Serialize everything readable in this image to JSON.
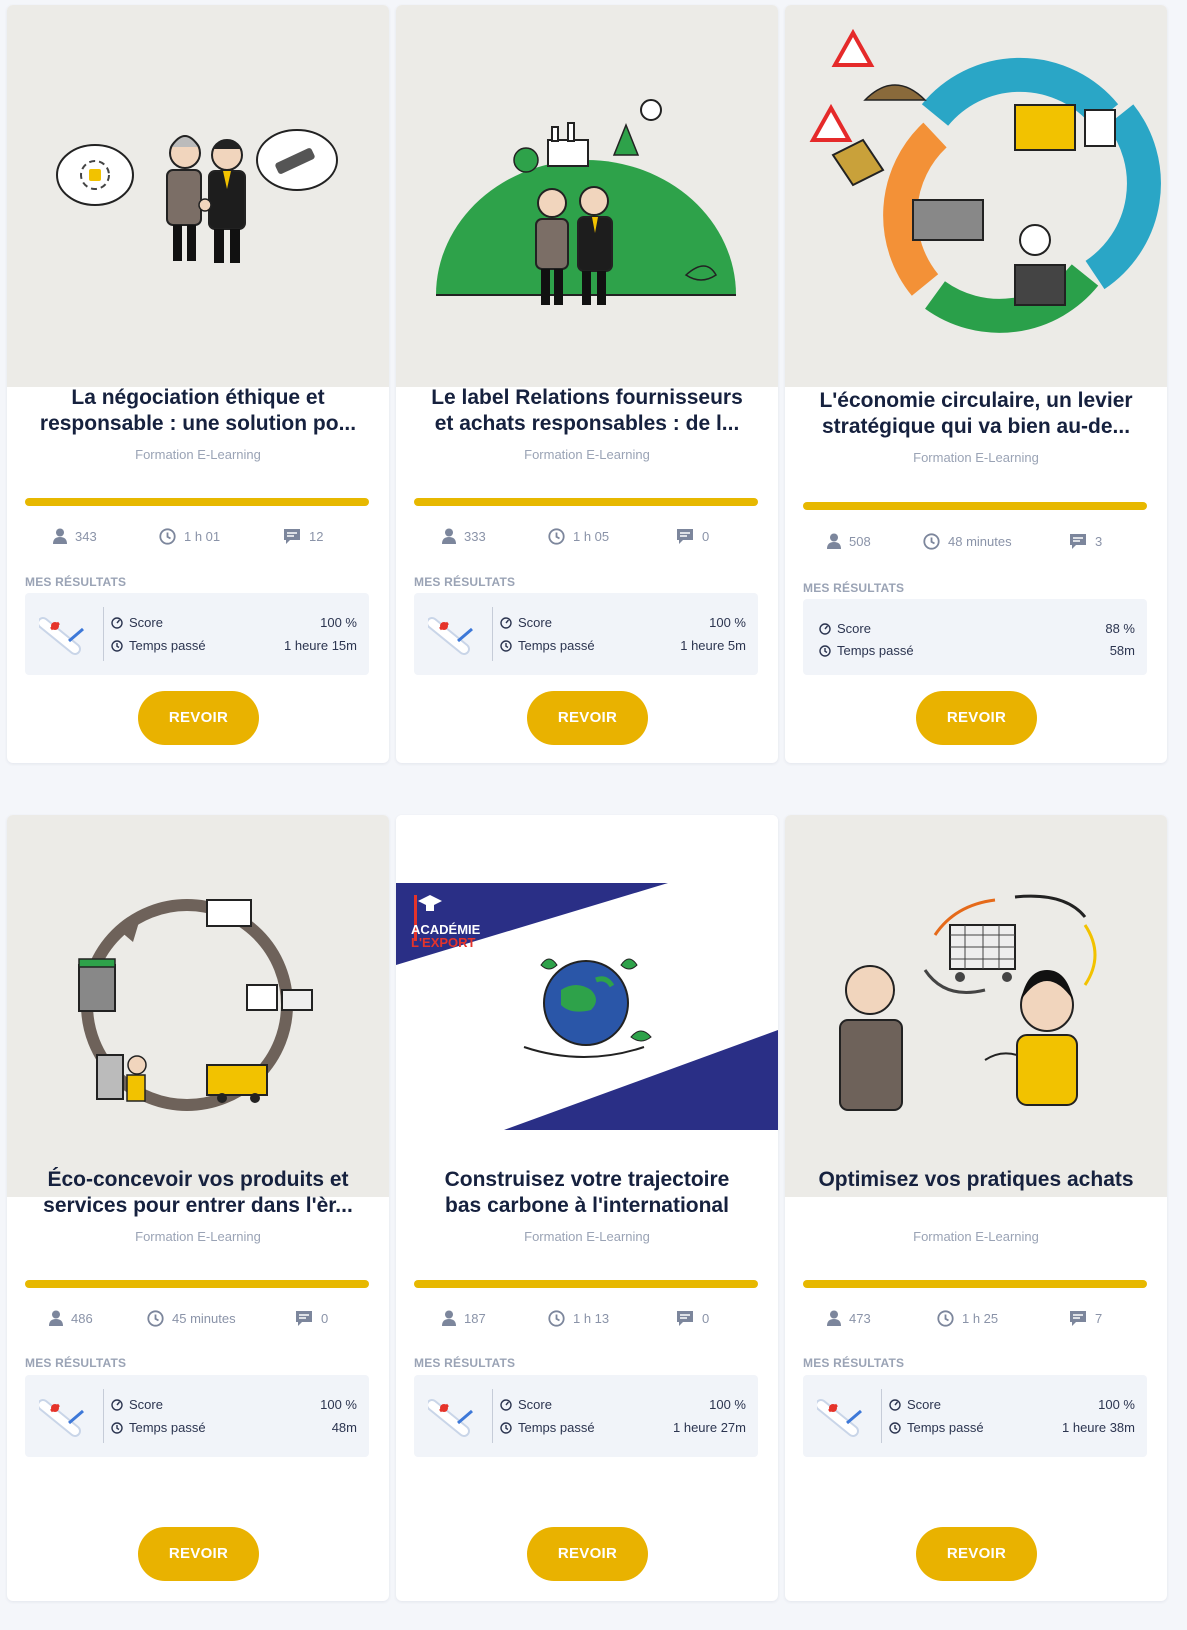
{
  "accent_color": "#e9b200",
  "cards": [
    {
      "title_line1": "La négociation éthique et",
      "title_line2": "responsable : une solution po...",
      "subtitle": "Formation E-Learning",
      "progress": 1.0,
      "stats": {
        "users": "343",
        "duration": "1 h 01",
        "comments": "12"
      },
      "results_label": "MES RÉSULTATS",
      "score_label": "Score",
      "score_value": "100 %",
      "time_label": "Temps passé",
      "time_value": "1 heure 15m",
      "button_label": "REVOIR",
      "illustration": "negotiation-handshake"
    },
    {
      "title_line1": "Le label Relations fournisseurs",
      "title_line2": "et achats responsables : de l...",
      "subtitle": "Formation E-Learning",
      "progress": 1.0,
      "stats": {
        "users": "333",
        "duration": "1 h 05",
        "comments": "0"
      },
      "results_label": "MES RÉSULTATS",
      "score_label": "Score",
      "score_value": "100 %",
      "time_label": "Temps passé",
      "time_value": "1 heure 5m",
      "button_label": "REVOIR",
      "illustration": "green-planet-handshake"
    },
    {
      "title_line1": "L'économie circulaire, un levier",
      "title_line2": "stratégique qui va bien au-de...",
      "subtitle": "Formation E-Learning",
      "progress": 1.0,
      "stats": {
        "users": "508",
        "duration": "48 minutes",
        "comments": "3"
      },
      "results_label": "MES RÉSULTATS",
      "score_label": "Score",
      "score_value": "88 %",
      "time_label": "Temps passé",
      "time_value": "58m",
      "button_label": "REVOIR",
      "illustration": "circular-economy-arrows"
    },
    {
      "title_line1": "Éco-concevoir vos produits et",
      "title_line2": "services pour entrer dans l'èr...",
      "subtitle": "Formation E-Learning",
      "progress": 1.0,
      "stats": {
        "users": "486",
        "duration": "45 minutes",
        "comments": "0"
      },
      "results_label": "MES RÉSULTATS",
      "score_label": "Score",
      "score_value": "100 %",
      "time_label": "Temps passé",
      "time_value": "48m",
      "button_label": "REVOIR",
      "illustration": "eco-design-cycle"
    },
    {
      "title_line1": "Construisez votre trajectoire",
      "title_line2": "bas carbone à l'international",
      "subtitle": "Formation E-Learning",
      "progress": 1.0,
      "stats": {
        "users": "187",
        "duration": "1 h 13",
        "comments": "0"
      },
      "results_label": "MES RÉSULTATS",
      "score_label": "Score",
      "score_value": "100 %",
      "time_label": "Temps passé",
      "time_value": "1 heure 27m",
      "button_label": "REVOIR",
      "illustration": "academie-export-globe",
      "logo_text_1": "ACADÉMIE",
      "logo_text_2": "L'EXPORT"
    },
    {
      "title_line1": "Optimisez vos pratiques achats",
      "title_line2": "",
      "subtitle": "Formation E-Learning",
      "progress": 1.0,
      "stats": {
        "users": "473",
        "duration": "1 h 25",
        "comments": "7"
      },
      "results_label": "MES RÉSULTATS",
      "score_label": "Score",
      "score_value": "100 %",
      "time_label": "Temps passé",
      "time_value": "1 heure 38m",
      "button_label": "REVOIR",
      "illustration": "shopping-cart-discussion"
    }
  ]
}
